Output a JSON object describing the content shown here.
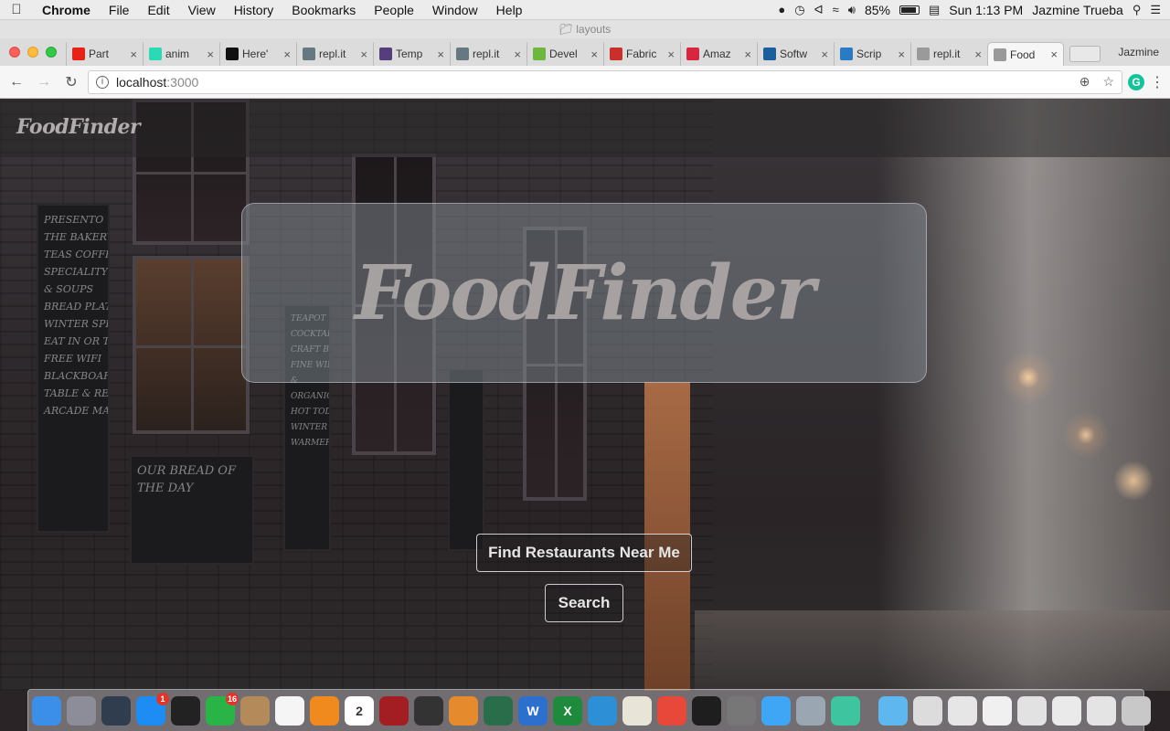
{
  "menubar": {
    "app": "Chrome",
    "items": [
      "File",
      "Edit",
      "View",
      "History",
      "Bookmarks",
      "People",
      "Window",
      "Help"
    ],
    "battery": "85%",
    "clock": "Sun 1:13 PM",
    "user": "Jazmine Trueba"
  },
  "window": {
    "title": "layouts"
  },
  "tabs": [
    {
      "label": "Part",
      "icon": "youtube-icon",
      "color": "#e62117"
    },
    {
      "label": "anim",
      "icon": "play-icon",
      "color": "#2bd9b5"
    },
    {
      "label": "Here'",
      "icon": "dev-icon",
      "color": "#111111"
    },
    {
      "label": "repl.it",
      "icon": "repl-icon",
      "color": "#667881"
    },
    {
      "label": "Temp",
      "icon": "bootstrap-icon",
      "color": "#563d7c"
    },
    {
      "label": "repl.it",
      "icon": "repl-icon",
      "color": "#667881"
    },
    {
      "label": "Devel",
      "icon": "devpost-icon",
      "color": "#6cb73c"
    },
    {
      "label": "Fabric",
      "icon": "fabric-icon",
      "color": "#c9302c"
    },
    {
      "label": "Amaz",
      "icon": "info-icon",
      "color": "#d7263d"
    },
    {
      "label": "Softw",
      "icon": "c-icon",
      "color": "#1a5e9e"
    },
    {
      "label": "Scrip",
      "icon": "w-icon",
      "color": "#2a7bc6"
    },
    {
      "label": "repl.it",
      "icon": "page-icon",
      "color": "#9a9a9a"
    },
    {
      "label": "Food",
      "icon": "page-icon",
      "color": "#9a9a9a",
      "active": true
    }
  ],
  "profile": "Jazmine",
  "address": {
    "host": "localhost",
    "port": ":3000"
  },
  "page": {
    "brand": "FoodFinder",
    "hero_title": "FoodFinder",
    "find_button": "Find Restaurants Near Me",
    "search_button": "Search"
  },
  "background": {
    "board_text": "PRESENTO\nTHE BAKERY\nTEAS COFFEE & CAKE\nSPECIALITY SANDWICH\n& SOUPS\nBREAD PLATTERS\nWINTER SPECIALS\nEAT IN OR TAKEAWAY\nFREE WIFI\nBLACKBOARD, PIE\nTABLE & RETRO\nARCADE MACHINE",
    "board2_text": "OUR BREAD OF THE DAY",
    "board3_text": "TEAPOT\nCOCKTAILS\nCRAFT BEERS\nFINE WINES\n&\nORGANIC CIDER\nHOT TODDY'S\nWINTER\nWARMERS"
  },
  "dock": {
    "apps": [
      {
        "name": "finder-icon",
        "color": "#3b8fe8"
      },
      {
        "name": "launchpad-icon",
        "color": "#8d8d99"
      },
      {
        "name": "mission-control-icon",
        "color": "#2f3d4e"
      },
      {
        "name": "app-store-icon",
        "color": "#1d8cf3",
        "badge": "1"
      },
      {
        "name": "dashboard-icon",
        "color": "#222222"
      },
      {
        "name": "facetime-icon",
        "color": "#2ab448",
        "badge": "16"
      },
      {
        "name": "contacts-icon",
        "color": "#b48a5a"
      },
      {
        "name": "itunes-icon",
        "color": "#f5f5f5"
      },
      {
        "name": "ibooks-icon",
        "color": "#f08a1f"
      },
      {
        "name": "calendar-icon",
        "color": "#ffffff",
        "text": "2"
      },
      {
        "name": "photo-booth-icon",
        "color": "#a31e22"
      },
      {
        "name": "imovie-icon",
        "color": "#333333"
      },
      {
        "name": "garageband-icon",
        "color": "#e58a2d"
      },
      {
        "name": "time-machine-icon",
        "color": "#2a6d4a"
      },
      {
        "name": "word-icon",
        "color": "#2c6fcd",
        "text": "W"
      },
      {
        "name": "excel-icon",
        "color": "#1f8a3e",
        "text": "X"
      },
      {
        "name": "lync-icon",
        "color": "#2d8fd5"
      },
      {
        "name": "preview-icon",
        "color": "#e9e4d8"
      },
      {
        "name": "chrome-icon",
        "color": "#e8483a"
      },
      {
        "name": "terminal-icon",
        "color": "#1e1e1e"
      },
      {
        "name": "system-tools-icon",
        "color": "#777777"
      },
      {
        "name": "messages-icon",
        "color": "#3ea6f5"
      },
      {
        "name": "image-capture-icon",
        "color": "#9aa7b3"
      },
      {
        "name": "atom-icon",
        "color": "#3ec59f"
      }
    ],
    "docs": [
      {
        "name": "downloads-folder-icon",
        "color": "#5fb7f0"
      },
      {
        "name": "document-stack-icon",
        "color": "#dcdcdc"
      },
      {
        "name": "document-stack-icon",
        "color": "#e6e6e6"
      },
      {
        "name": "document-stack-icon",
        "color": "#f0f0f0"
      },
      {
        "name": "document-stack-icon",
        "color": "#e2e2e2"
      },
      {
        "name": "document-stack-icon",
        "color": "#eaeaea"
      },
      {
        "name": "document-stack-icon",
        "color": "#e4e4e4"
      },
      {
        "name": "trash-icon",
        "color": "#c8c8c8"
      }
    ]
  }
}
